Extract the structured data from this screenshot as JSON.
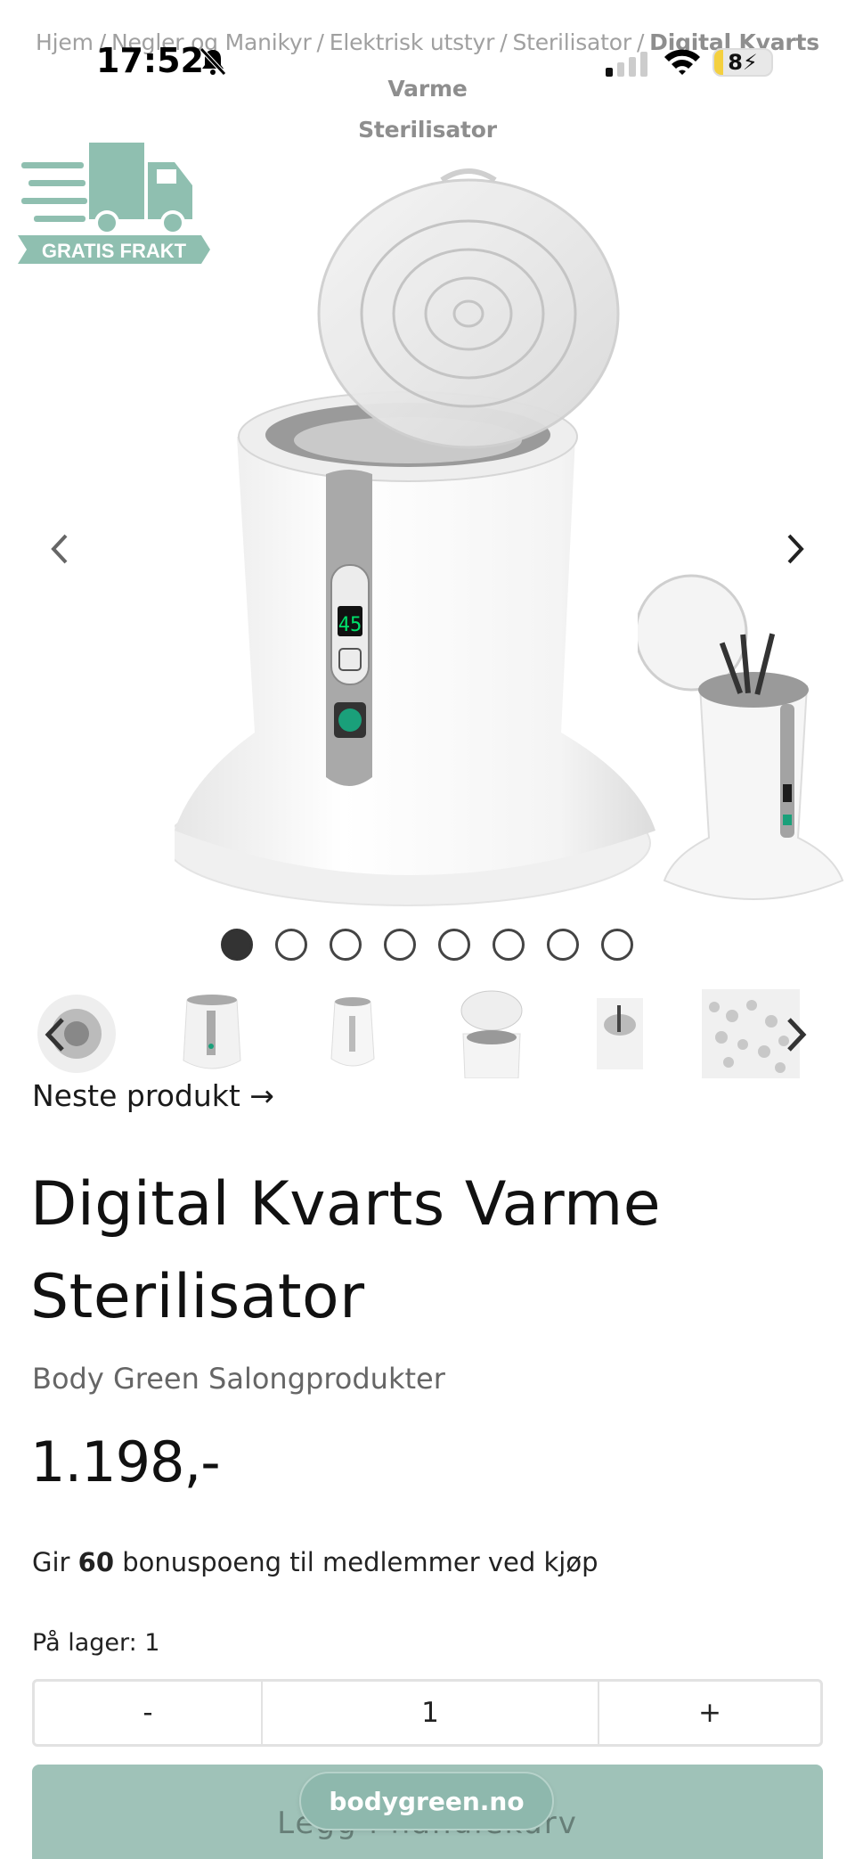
{
  "breadcrumb": {
    "items": [
      "Hjem",
      "Negler og Manikyr",
      "Elektrisk utstyr",
      "Sterilisator"
    ],
    "separator": "/",
    "current_line1": "Digital Kvarts Varme",
    "current_line2": "Sterilisator"
  },
  "status_bar": {
    "time": "17:52",
    "battery": "8",
    "battery_charging": true,
    "battery_level": 0.08
  },
  "gallery": {
    "badge_text": "GRATIS FRAKT",
    "device_display": "45",
    "slide_count": 8,
    "active_slide": 1,
    "thumbnail_count": 6
  },
  "next_product_label": "Neste produkt →",
  "product": {
    "title_line1": "Digital Kvarts Varme",
    "title_line2": "Sterilisator",
    "brand": "Body Green Salongprodukter",
    "price": "1.198,-",
    "bonus_prefix": "Gir",
    "bonus_points": "60",
    "bonus_suffix": "bonuspoeng til medlemmer ved kjøp",
    "stock": "På lager: 1"
  },
  "quantity": {
    "minus": "-",
    "value": "1",
    "plus": "+"
  },
  "cart": {
    "label": "Legg i handlekurv"
  },
  "browser": {
    "url": "bodygreen.no"
  },
  "colors": {
    "accent": "#9fc2b8",
    "badge": "#8fbfb0",
    "device_led": "#00e06a",
    "button_green": "#1aa07a"
  }
}
